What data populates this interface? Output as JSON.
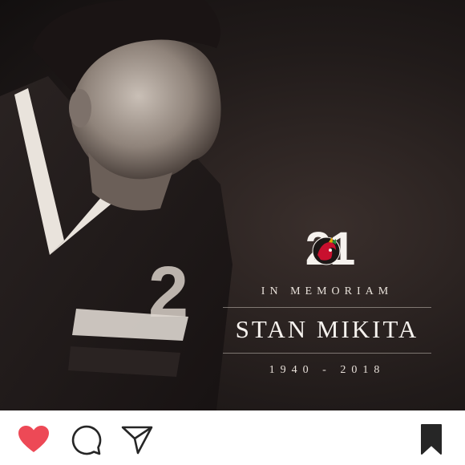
{
  "post": {
    "jersey_number": "21",
    "subtitle": "IN MEMORIAM",
    "name": "STAN MIKITA",
    "years": "1940 - 2018"
  },
  "icons": {
    "like": "heart-icon",
    "comment": "comment-icon",
    "share": "paper-plane-icon",
    "save": "bookmark-icon"
  },
  "colors": {
    "like": "#ed4956",
    "icon": "#262626",
    "photo_background": "#1c1716"
  }
}
